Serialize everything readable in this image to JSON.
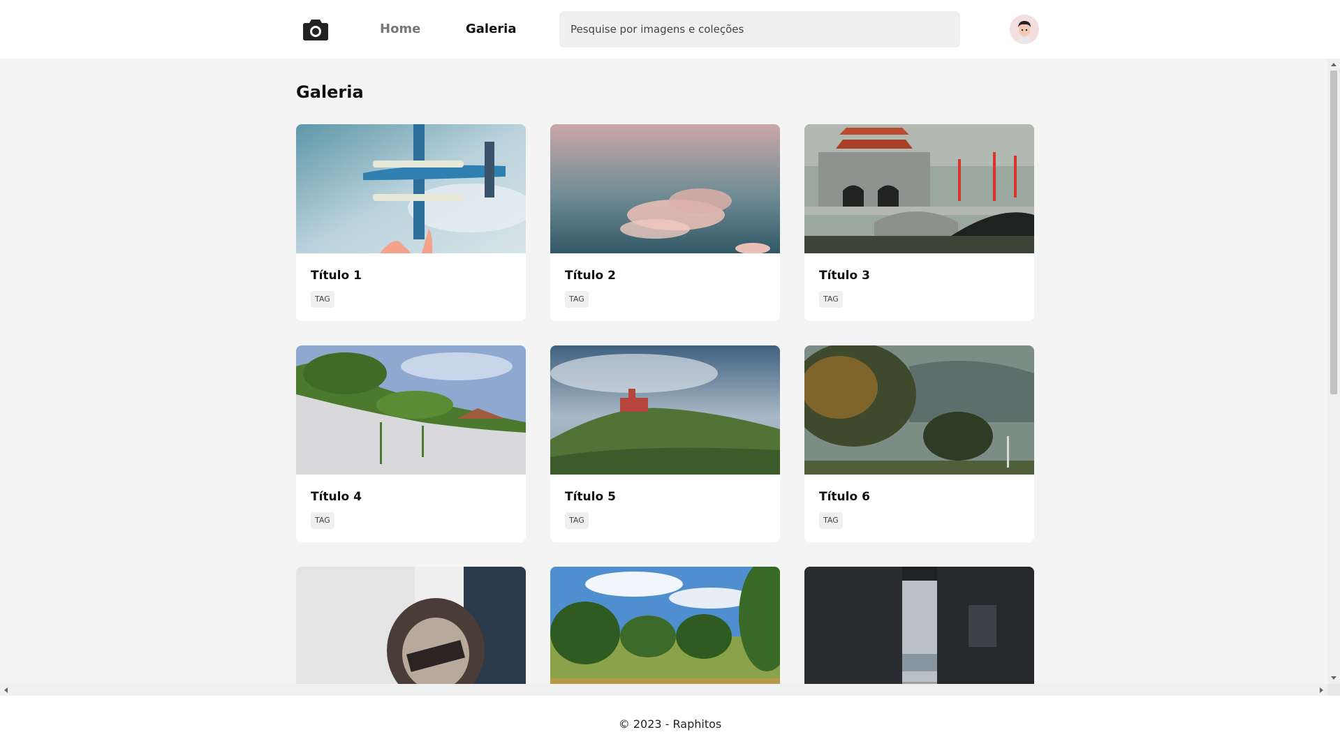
{
  "header": {
    "logo_icon": "camera-icon",
    "nav": [
      {
        "label": "Home"
      },
      {
        "label": "Galeria"
      }
    ],
    "search": {
      "value": "",
      "placeholder": "Pesquise por imagens e coleções"
    },
    "avatar_icon": "user-avatar"
  },
  "main": {
    "title": "Galeria",
    "cards": [
      {
        "title": "Título 1",
        "tag": "TAG",
        "image": "seaplane-sky"
      },
      {
        "title": "Título 2",
        "tag": "TAG",
        "image": "pink-clouds"
      },
      {
        "title": "Título 3",
        "tag": "TAG",
        "image": "temple-bridge"
      },
      {
        "title": "Título 4",
        "tag": "TAG",
        "image": "ivy-wall"
      },
      {
        "title": "Título 5",
        "tag": "TAG",
        "image": "castle-hill"
      },
      {
        "title": "Título 6",
        "tag": "TAG",
        "image": "misty-trees"
      },
      {
        "title": "",
        "tag": "",
        "image": "valley-sign"
      },
      {
        "title": "",
        "tag": "",
        "image": "orchard-field"
      },
      {
        "title": "",
        "tag": "",
        "image": "dark-alley-lake"
      }
    ]
  },
  "footer": {
    "text": "© 2023 - Raphitos"
  },
  "colors": {
    "background": "#f4f4f4",
    "card": "#ffffff",
    "search_bg": "#efefef",
    "nav_inactive": "#777777"
  }
}
